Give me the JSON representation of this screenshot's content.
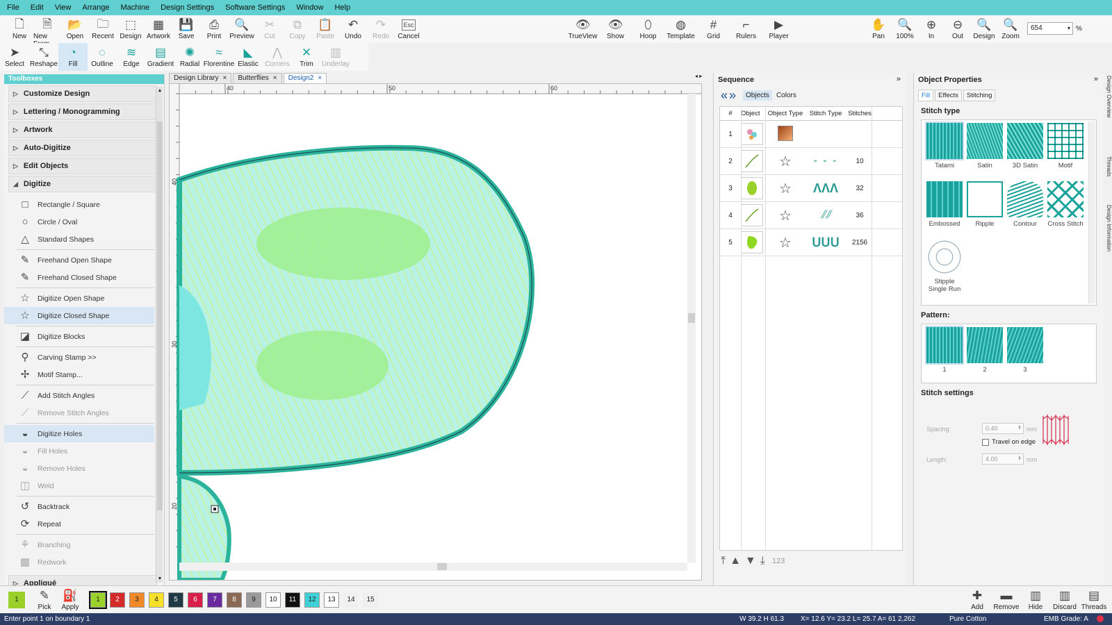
{
  "menu": [
    "File",
    "Edit",
    "View",
    "Arrange",
    "Machine",
    "Design Settings",
    "Software Settings",
    "Window",
    "Help"
  ],
  "toolbar1_left": [
    {
      "label": "New",
      "icon": "new-file-icon",
      "glyph": "🗋",
      "enabled": true
    },
    {
      "label": "New From",
      "icon": "new-from-icon",
      "glyph": "🗎",
      "enabled": true
    },
    {
      "label": "Open",
      "icon": "open-folder-icon",
      "glyph": "📂",
      "enabled": true
    },
    {
      "label": "Recent",
      "icon": "recent-icon",
      "glyph": "🗀",
      "enabled": true
    },
    {
      "label": "Design",
      "icon": "design-icon",
      "glyph": "⬚",
      "enabled": true
    },
    {
      "label": "Artwork",
      "icon": "artwork-icon",
      "glyph": "▦",
      "enabled": true
    },
    {
      "label": "Save",
      "icon": "save-icon",
      "glyph": "💾",
      "enabled": true
    },
    {
      "label": "Print",
      "icon": "print-icon",
      "glyph": "⎙",
      "enabled": true
    },
    {
      "label": "Preview",
      "icon": "preview-icon",
      "glyph": "🔍",
      "enabled": true
    },
    {
      "label": "Cut",
      "icon": "cut-icon",
      "glyph": "✂",
      "enabled": false
    },
    {
      "label": "Copy",
      "icon": "copy-icon",
      "glyph": "⧉",
      "enabled": false
    },
    {
      "label": "Paste",
      "icon": "paste-icon",
      "glyph": "📋",
      "enabled": false
    },
    {
      "label": "Undo",
      "icon": "undo-icon",
      "glyph": "↶",
      "enabled": true
    },
    {
      "label": "Redo",
      "icon": "redo-icon",
      "glyph": "↷",
      "enabled": false
    },
    {
      "label": "Cancel",
      "icon": "cancel-icon",
      "glyph": "Esc",
      "enabled": true
    }
  ],
  "toolbar1_mid": [
    {
      "label": "TrueView",
      "icon": "trueview-icon",
      "glyph": "👁"
    },
    {
      "label": "Show",
      "icon": "show-icon",
      "glyph": "👁"
    },
    {
      "label": "Hoop",
      "icon": "hoop-icon",
      "glyph": "⬯"
    },
    {
      "label": "Template",
      "icon": "template-icon",
      "glyph": "◍"
    },
    {
      "label": "Grid",
      "icon": "grid-icon",
      "glyph": "#"
    },
    {
      "label": "Rulers",
      "icon": "rulers-icon",
      "glyph": "⌐"
    },
    {
      "label": "Player",
      "icon": "player-icon",
      "glyph": "▶"
    }
  ],
  "toolbar1_right": [
    {
      "label": "Pan",
      "icon": "pan-hand-icon",
      "glyph": "✋"
    },
    {
      "label": "100%",
      "icon": "zoom-100-icon",
      "glyph": "🔍"
    },
    {
      "label": "In",
      "icon": "zoom-in-icon",
      "glyph": "⊕"
    },
    {
      "label": "Out",
      "icon": "zoom-out-icon",
      "glyph": "⊖"
    },
    {
      "label": "Design",
      "icon": "zoom-design-icon",
      "glyph": "🔍"
    },
    {
      "label": "Zoom",
      "icon": "zoom-icon",
      "glyph": "🔍"
    }
  ],
  "zoom": {
    "value": "654",
    "unit": "%"
  },
  "toolbar2": [
    {
      "label": "Select",
      "icon": "select-arrow-icon",
      "glyph": "➤",
      "enabled": true
    },
    {
      "label": "Reshape",
      "icon": "reshape-icon",
      "glyph": "⤡",
      "enabled": true
    },
    {
      "label": "Fill",
      "icon": "fill-icon",
      "glyph": "◔",
      "enabled": true,
      "active": true
    },
    {
      "label": "Outline",
      "icon": "outline-icon",
      "glyph": "◌",
      "enabled": true
    },
    {
      "label": "Edge",
      "icon": "edge-icon",
      "glyph": "≋",
      "enabled": true
    },
    {
      "label": "Gradient",
      "icon": "gradient-icon",
      "glyph": "▤",
      "enabled": true
    },
    {
      "label": "Radial",
      "icon": "radial-icon",
      "glyph": "✺",
      "enabled": true
    },
    {
      "label": "Florentine",
      "icon": "florentine-icon",
      "glyph": "≈",
      "enabled": true
    },
    {
      "label": "Elastic",
      "icon": "elastic-icon",
      "glyph": "◣",
      "enabled": true
    },
    {
      "label": "Corners",
      "icon": "corners-icon",
      "glyph": "⋀",
      "enabled": false
    },
    {
      "label": "Trim",
      "icon": "trim-icon",
      "glyph": "✕",
      "enabled": true
    },
    {
      "label": "Underlay",
      "icon": "underlay-icon",
      "glyph": "▥",
      "enabled": false
    }
  ],
  "toolbox": {
    "title": "Toolboxes",
    "categories_top": [
      "Customize Design",
      "Lettering / Monogramming",
      "Artwork",
      "Auto-Digitize",
      "Edit Objects"
    ],
    "digitize_label": "Digitize",
    "items": [
      [
        {
          "label": "Rectangle / Square",
          "icon": "rectangle-icon",
          "glyph": "□"
        },
        {
          "label": "Circle / Oval",
          "icon": "circle-icon",
          "glyph": "○"
        },
        {
          "label": "Standard Shapes",
          "icon": "standard-shapes-icon",
          "glyph": "△"
        }
      ],
      [
        {
          "label": "Freehand Open Shape",
          "icon": "freehand-open-icon",
          "glyph": "✎"
        },
        {
          "label": "Freehand Closed Shape",
          "icon": "freehand-closed-icon",
          "glyph": "✎"
        }
      ],
      [
        {
          "label": "Digitize Open Shape",
          "icon": "digitize-open-icon",
          "glyph": "☆"
        },
        {
          "label": "Digitize Closed Shape",
          "icon": "digitize-closed-icon",
          "glyph": "☆",
          "selected": true
        }
      ],
      [
        {
          "label": "Digitize Blocks",
          "icon": "digitize-blocks-icon",
          "glyph": "◪"
        }
      ],
      [
        {
          "label": "Carving Stamp >>",
          "icon": "carving-stamp-icon",
          "glyph": "⚲"
        },
        {
          "label": "Motif Stamp...",
          "icon": "motif-stamp-icon",
          "glyph": "✢"
        }
      ],
      [
        {
          "label": "Add Stitch Angles",
          "icon": "add-angles-icon",
          "glyph": "⟋"
        },
        {
          "label": "Remove Stitch Angles",
          "icon": "remove-angles-icon",
          "glyph": "⟋",
          "disabled": true
        }
      ],
      [
        {
          "label": "Digitize Holes",
          "icon": "digitize-holes-icon",
          "glyph": "◒",
          "selected": true
        },
        {
          "label": "Fill Holes",
          "icon": "fill-holes-icon",
          "glyph": "◒",
          "disabled": true
        },
        {
          "label": "Remove Holes",
          "icon": "remove-holes-icon",
          "glyph": "◒",
          "disabled": true
        },
        {
          "label": "Weld",
          "icon": "weld-icon",
          "glyph": "◫",
          "disabled": true
        }
      ],
      [
        {
          "label": "Backtrack",
          "icon": "backtrack-icon",
          "glyph": "↺"
        },
        {
          "label": "Repeat",
          "icon": "repeat-icon",
          "glyph": "⟳"
        }
      ],
      [
        {
          "label": "Branching",
          "icon": "branching-icon",
          "glyph": "⚘",
          "disabled": true
        },
        {
          "label": "Redwork",
          "icon": "redwork-icon",
          "glyph": "▩",
          "disabled": true
        }
      ]
    ],
    "bottom_category": "Appliqué"
  },
  "doc_tabs": [
    {
      "label": "Design Library",
      "active": false
    },
    {
      "label": "Butterflies",
      "active": false
    },
    {
      "label": "Design2",
      "active": true
    }
  ],
  "rulers": {
    "h": [
      "40",
      "50",
      "60"
    ],
    "v": [
      "40",
      "30",
      "20"
    ]
  },
  "sequence": {
    "title": "Sequence",
    "tabs": [
      "Objects",
      "Colors"
    ],
    "headers": [
      "#",
      "Object",
      "Object Type",
      "Stitch Type",
      "Stitches"
    ],
    "rows": [
      {
        "n": "1",
        "stitches": ""
      },
      {
        "n": "2",
        "stitches": "10"
      },
      {
        "n": "3",
        "stitches": "32"
      },
      {
        "n": "4",
        "stitches": "36"
      },
      {
        "n": "5",
        "stitches": "2156"
      }
    ],
    "bottom_label": "123"
  },
  "props": {
    "title": "Object Properties",
    "tabs": [
      "Fill",
      "Effects",
      "Stitching"
    ],
    "stitch_type_label": "Stitch type",
    "stitch_types": [
      "Tatami",
      "Satin",
      "3D Satin",
      "Motif",
      "Embossed",
      "Ripple",
      "Contour",
      "Cross Stitch",
      "Stipple Single Run"
    ],
    "pattern_label": "Pattern:",
    "patterns": [
      "1",
      "2",
      "3"
    ],
    "settings_label": "Stitch settings",
    "spacing_label": "Spacing:",
    "spacing_value": "0.40",
    "travel_label": "Travel on edge",
    "length_label": "Length:",
    "length_value": "4.00",
    "unit": "mm"
  },
  "vtabs": [
    "Design Overview",
    "Threads",
    "Design Information"
  ],
  "colorbar": {
    "current": "1",
    "pick_label": "Pick",
    "apply_label": "Apply",
    "chips": [
      {
        "n": "1",
        "color": "#9ad02a"
      },
      {
        "n": "2",
        "color": "#d42a2a"
      },
      {
        "n": "3",
        "color": "#f08a28"
      },
      {
        "n": "4",
        "color": "#f6e02a"
      },
      {
        "n": "5",
        "color": "#1f3a44"
      },
      {
        "n": "6",
        "color": "#d8204a"
      },
      {
        "n": "7",
        "color": "#6a2aa0"
      },
      {
        "n": "8",
        "color": "#8a6a55"
      },
      {
        "n": "9",
        "color": "#9a9a9a"
      },
      {
        "n": "10",
        "color": "#ffffff"
      },
      {
        "n": "11",
        "color": "#111111"
      },
      {
        "n": "12",
        "color": "#3fd0d8"
      },
      {
        "n": "13",
        "color": "#ffffff"
      },
      {
        "n": "14",
        "color": "#f0f0f0"
      },
      {
        "n": "15",
        "color": "#f0f0f0"
      }
    ],
    "right": [
      {
        "label": "Add",
        "icon": "add-icon",
        "glyph": "✚"
      },
      {
        "label": "Remove",
        "icon": "remove-icon",
        "glyph": "▬"
      },
      {
        "label": "Hide",
        "icon": "hide-icon",
        "glyph": "▥"
      },
      {
        "label": "Discard",
        "icon": "discard-icon",
        "glyph": "▥"
      },
      {
        "label": "Threads",
        "icon": "threads-icon",
        "glyph": "▤"
      }
    ]
  },
  "status": {
    "hint": "Enter point 1 on boundary 1",
    "size": "W 39.2 H 61.3",
    "coords": "X= 12.6 Y= 23.2 L= 25.7 A= 61",
    "stitches": "2,262",
    "thread": "Pure Cotton",
    "grade": "EMB Grade: A"
  },
  "colors": {
    "accent": "#5fcfcf",
    "teal": "#1aa39a",
    "fill": "#aef0e0",
    "stripe": "#c6ec3a"
  }
}
